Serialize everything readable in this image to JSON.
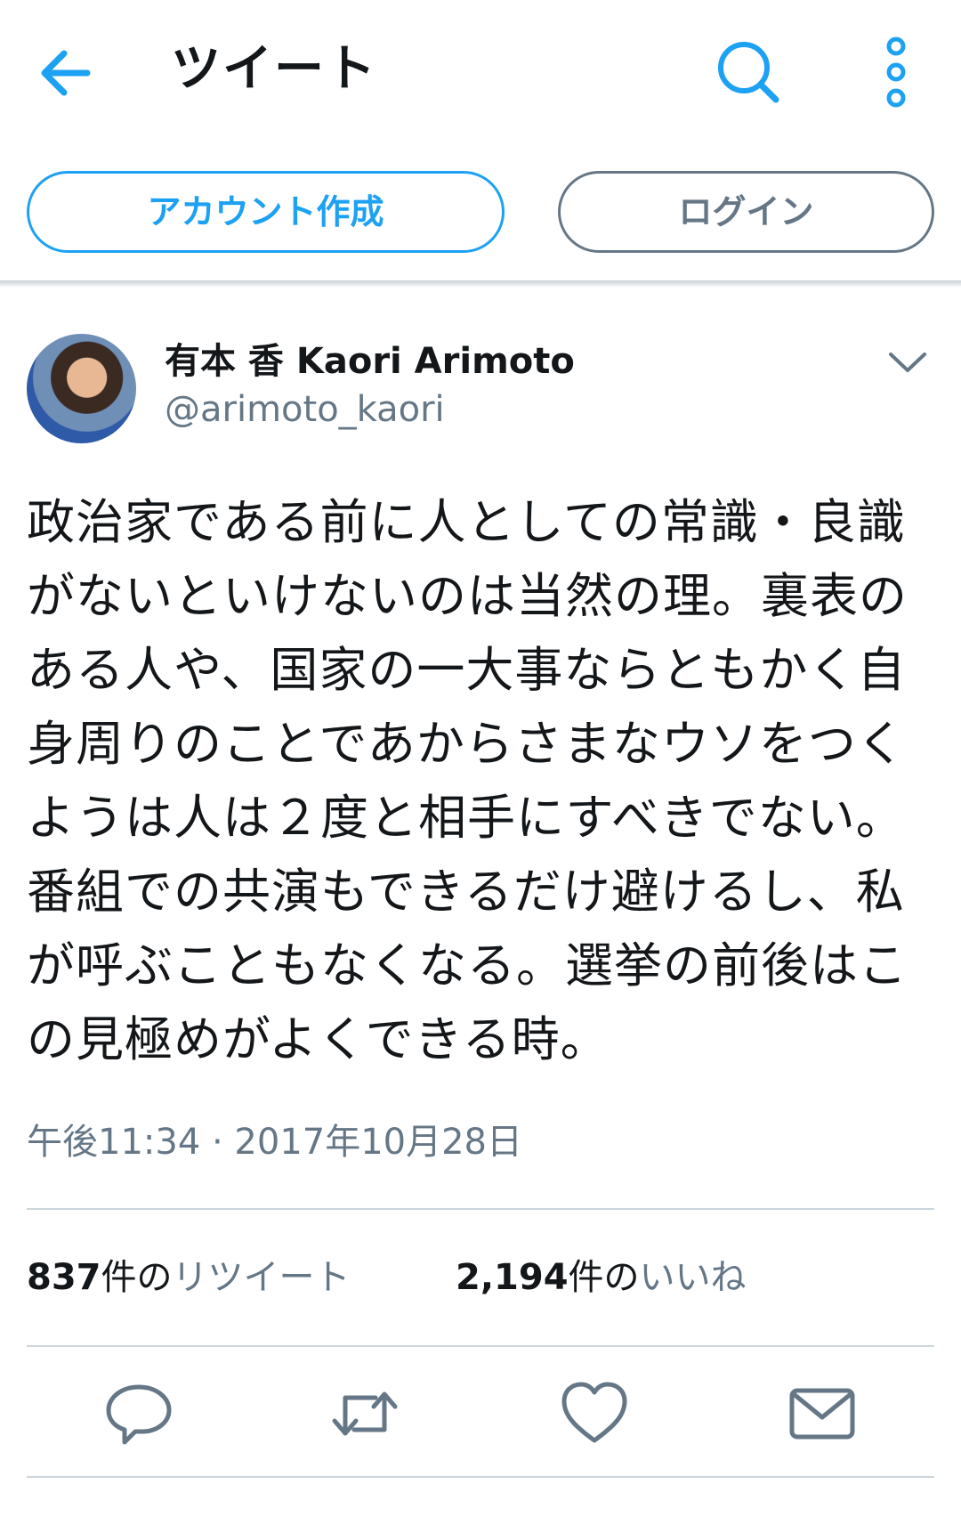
{
  "header": {
    "title": "ツイート"
  },
  "auth": {
    "signup_label": "アカウント作成",
    "login_label": "ログイン"
  },
  "tweet": {
    "display_name": "有本 香 Kaori Arimoto",
    "handle": "@arimoto_kaori",
    "text": "政治家である前に人としての常識・良識がないといけないのは当然の理。裏表のある人や、国家の一大事ならともかく自身周りのことであからさまなウソをつくようは人は２度と相手にすべきでない。番組での共演もできるだけ避けるし、私が呼ぶこともなくなる。選挙の前後はこの見極めがよくできる時。",
    "timestamp": "午後11:34 · 2017年10月28日"
  },
  "stats": {
    "retweets_count": "837",
    "retweets_unit": "件の",
    "retweets_label": "リツイート",
    "likes_count": "2,194",
    "likes_unit": "件の",
    "likes_label": "いいね"
  },
  "icons": [
    "back-arrow-icon",
    "search-icon",
    "more-vertical-icon",
    "chevron-down-icon",
    "reply-icon",
    "retweet-icon",
    "like-icon",
    "direct-message-icon"
  ],
  "colors": {
    "accent": "#1da1f2",
    "secondary_text": "#657786",
    "primary_text": "#14171a",
    "divider": "#ccd6dd"
  }
}
